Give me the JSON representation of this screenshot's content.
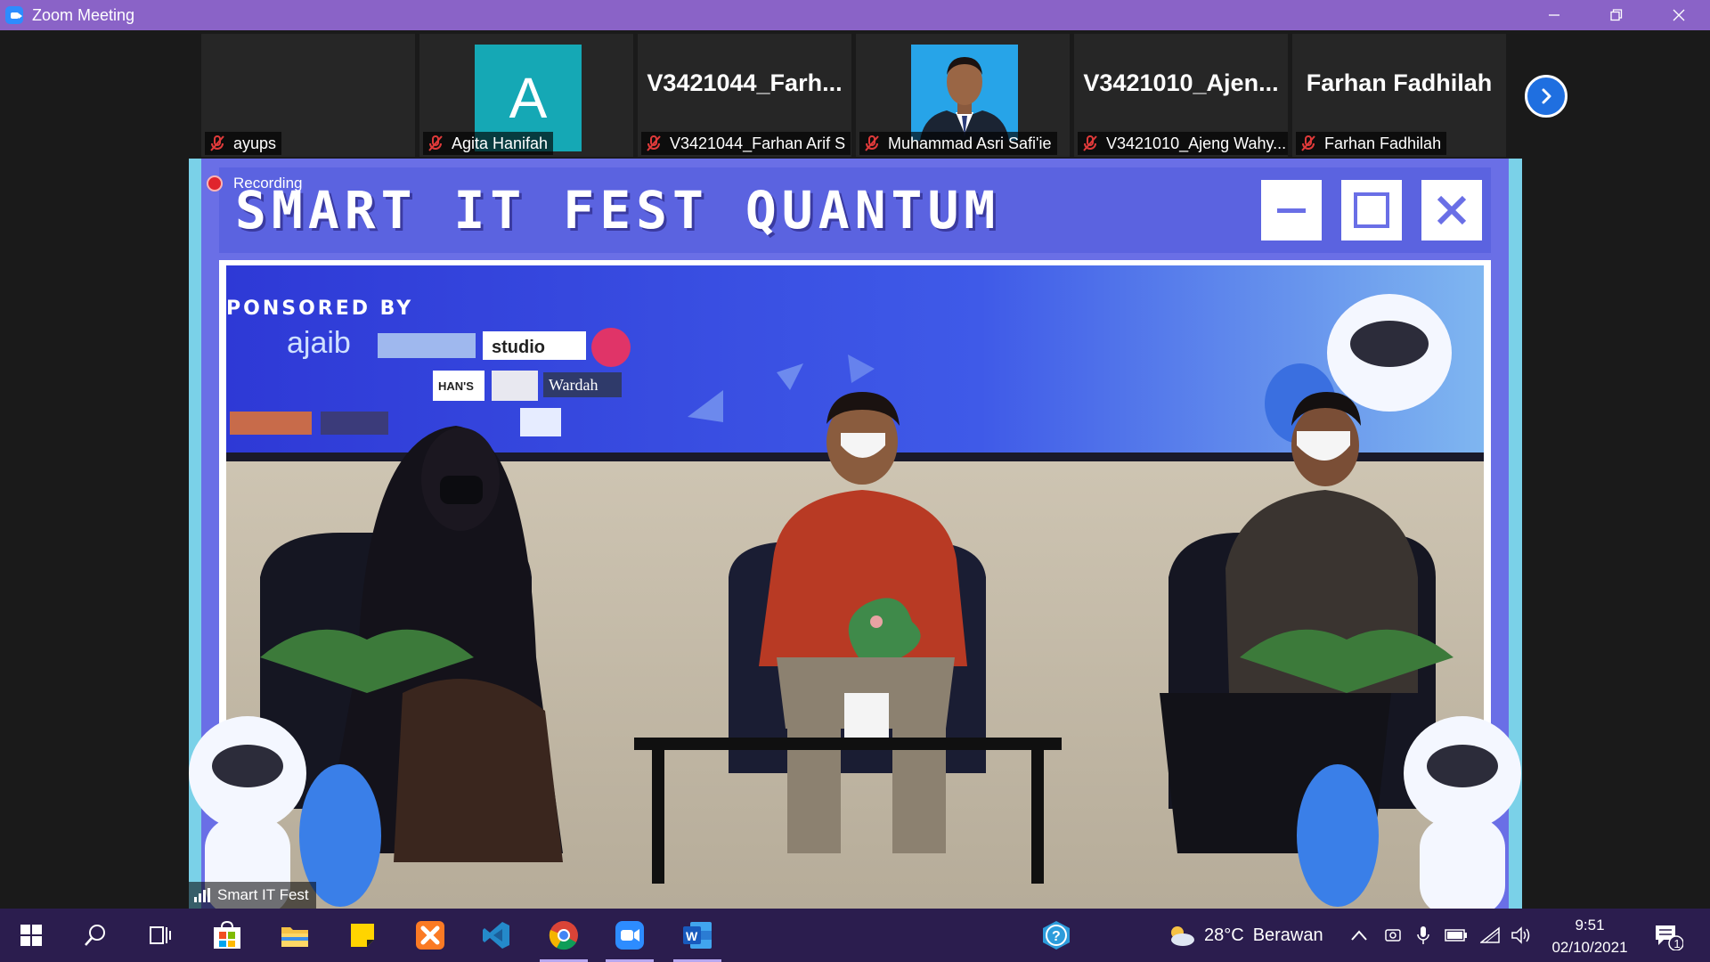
{
  "window": {
    "title": "Zoom Meeting"
  },
  "gallery": {
    "participants": [
      {
        "display_name": "",
        "label": "ayups",
        "muted": true,
        "video": "off"
      },
      {
        "display_name": "A",
        "label": "Agita Hanifah",
        "muted": true,
        "video": "avatar"
      },
      {
        "display_name": "V3421044_Farh...",
        "label": "V3421044_Farhan Arif S",
        "muted": true,
        "video": "off"
      },
      {
        "display_name": "",
        "label": "Muhammad Asri Safi'ie",
        "muted": true,
        "video": "photo"
      },
      {
        "display_name": "V3421010_Ajen...",
        "label": "V3421010_Ajeng Wahy...",
        "muted": true,
        "video": "off"
      },
      {
        "display_name": "Farhan Fadhilah",
        "label": "Farhan Fadhilah",
        "muted": true,
        "video": "off"
      }
    ]
  },
  "main_video": {
    "recording_label": "Recording",
    "banner_title": "SMART IT FEST QUANTUM",
    "sponsored_text": "PONSORED BY",
    "sponsor_logos": [
      "ajaib",
      "studio",
      "HAN'S",
      "Wardah"
    ],
    "speaker_label": "Smart IT Fest"
  },
  "taskbar": {
    "apps": [
      "start",
      "search",
      "task-view",
      "store",
      "file-explorer",
      "sticky-notes",
      "xampp",
      "vscode",
      "chrome",
      "zoom",
      "word"
    ],
    "active_apps": [
      "chrome",
      "zoom",
      "word"
    ],
    "weather": {
      "temp": "28°C",
      "condition": "Berawan"
    },
    "time": "9:51",
    "date": "02/10/2021",
    "notification_count": "1"
  },
  "colors": {
    "titlebar": "#8a63c7",
    "taskbar": "#2b1d4e",
    "zoom_blue": "#2d8cff",
    "banner_blue": "#5b63e0",
    "avatar_teal": "#15a8b5"
  }
}
